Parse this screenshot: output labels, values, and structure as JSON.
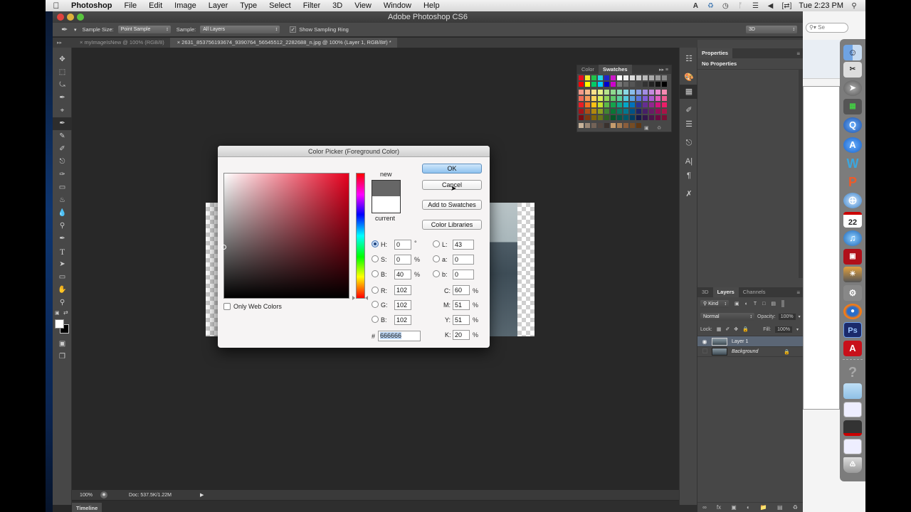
{
  "menubar": {
    "app_name": "Photoshop",
    "items": [
      "File",
      "Edit",
      "Image",
      "Layer",
      "Type",
      "Select",
      "Filter",
      "3D",
      "View",
      "Window",
      "Help"
    ],
    "clock": "Tue 2:23 PM",
    "status_icons": [
      "adobe-icon",
      "sync-icon",
      "time-machine-icon",
      "bluetooth-icon",
      "wifi-icon",
      "volume-icon",
      "battery-icon",
      "spotlight-icon"
    ]
  },
  "window": {
    "title": "Adobe Photoshop CS6"
  },
  "options_bar": {
    "tool_icon": "eyedropper-icon",
    "sample_size_label": "Sample Size:",
    "sample_size_value": "Point Sample",
    "sample_label": "Sample:",
    "sample_value": "All Layers",
    "show_ring_label": "Show Sampling Ring",
    "show_ring_checked": true,
    "workspace_value": "3D"
  },
  "doc_tabs": [
    {
      "label": "myImageIsNew @ 100% (RGB/8)",
      "active": false
    },
    {
      "label": "2631_853756193674_9390764_56545512_2282688_n.jpg @ 100% (Layer 1, RGB/8#) *",
      "active": true
    }
  ],
  "tools": [
    "move",
    "marquee",
    "lasso",
    "quick-select",
    "crop",
    "eyedropper",
    "healing-brush",
    "brush",
    "clone-stamp",
    "history-brush",
    "eraser",
    "paint-bucket",
    "blur",
    "dodge",
    "pen",
    "type",
    "path-select",
    "rectangle",
    "hand",
    "zoom"
  ],
  "selected_tool": "eyedropper",
  "status_bar": {
    "zoom": "100%",
    "doc_info": "Doc: 537.5K/1.22M"
  },
  "timeline_tab": "Timeline",
  "color_picker": {
    "title": "Color Picker (Foreground Color)",
    "new_label": "new",
    "current_label": "current",
    "new_color": "#666666",
    "current_color": "#ffffff",
    "buttons": {
      "ok": "OK",
      "cancel": "Cancel",
      "add_to_swatches": "Add to Swatches",
      "color_libraries": "Color Libraries"
    },
    "only_web_colors_label": "Only Web Colors",
    "only_web_colors_checked": false,
    "selected_mode": "H",
    "fields": {
      "H": {
        "label": "H:",
        "value": "0",
        "unit": "°"
      },
      "S": {
        "label": "S:",
        "value": "0",
        "unit": "%"
      },
      "B": {
        "label": "B:",
        "value": "40",
        "unit": "%"
      },
      "R": {
        "label": "R:",
        "value": "102"
      },
      "G": {
        "label": "G:",
        "value": "102"
      },
      "Bl": {
        "label": "B:",
        "value": "102"
      },
      "L": {
        "label": "L:",
        "value": "43"
      },
      "a": {
        "label": "a:",
        "value": "0"
      },
      "b": {
        "label": "b:",
        "value": "0"
      },
      "C": {
        "label": "C:",
        "value": "60",
        "unit": "%"
      },
      "M": {
        "label": "M:",
        "value": "51",
        "unit": "%"
      },
      "Y": {
        "label": "Y:",
        "value": "51",
        "unit": "%"
      },
      "K": {
        "label": "K:",
        "value": "20",
        "unit": "%"
      }
    },
    "hex_label": "#",
    "hex_value": "666666"
  },
  "swatches_panel": {
    "tabs": [
      "Color",
      "Swatches"
    ],
    "active_tab": "Swatches"
  },
  "properties_panel": {
    "tab": "Properties",
    "content": "No Properties"
  },
  "layers_panel": {
    "tabs": [
      "3D",
      "Layers",
      "Channels"
    ],
    "active_tab": "Layers",
    "filter_kind": "Kind",
    "blend_mode": "Normal",
    "opacity_label": "Opacity:",
    "opacity": "100%",
    "lock_label": "Lock:",
    "fill_label": "Fill:",
    "fill": "100%",
    "layers": [
      {
        "name": "Layer 1",
        "visible": true,
        "selected": true,
        "locked": false
      },
      {
        "name": "Background",
        "visible": false,
        "selected": false,
        "locked": true
      }
    ]
  },
  "dock": {
    "apps": [
      "Finder",
      "Text Edit",
      "Launchpad",
      "Network Utility",
      "QuickTime",
      "App Store",
      "Word",
      "Pages",
      "Safari",
      "Calendar",
      "iTunes",
      "Photo Booth",
      "iPhoto",
      "System Preferences",
      "Firefox",
      "Photoshop",
      "Acrobat",
      "Help",
      "Folder",
      "Window 1",
      "Window 2",
      "Window 3",
      "Trash"
    ],
    "calendar_day": "22"
  },
  "background_window": {
    "search_placeholder": "Se"
  }
}
